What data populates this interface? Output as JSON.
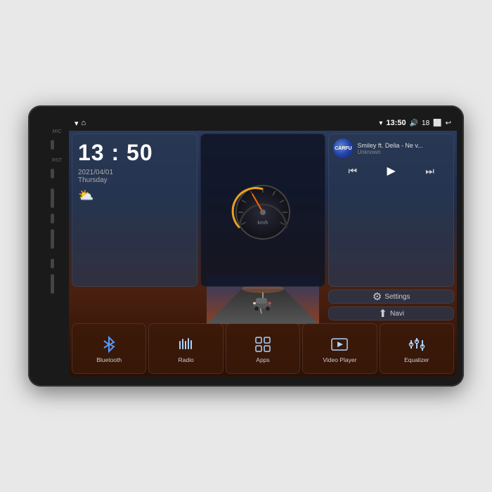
{
  "device": {
    "background": "#e8e8e8"
  },
  "statusBar": {
    "time": "13:50",
    "battery": "18",
    "wifi": true
  },
  "clock": {
    "time": "13 : 50",
    "date": "2021/04/01",
    "day": "Thursday"
  },
  "music": {
    "logo": "CARFU",
    "title": "Smiley ft. Delia - Ne v...",
    "artist": "Unknown"
  },
  "speedo": {
    "unit": "km/h"
  },
  "settings": {
    "label": "Settings"
  },
  "navi": {
    "label": "Navi"
  },
  "apps": [
    {
      "id": "bluetooth",
      "label": "Bluetooth"
    },
    {
      "id": "radio",
      "label": "Radio"
    },
    {
      "id": "apps",
      "label": "Apps"
    },
    {
      "id": "video-player",
      "label": "Video Player"
    },
    {
      "id": "equalizer",
      "label": "Equalizer"
    }
  ]
}
